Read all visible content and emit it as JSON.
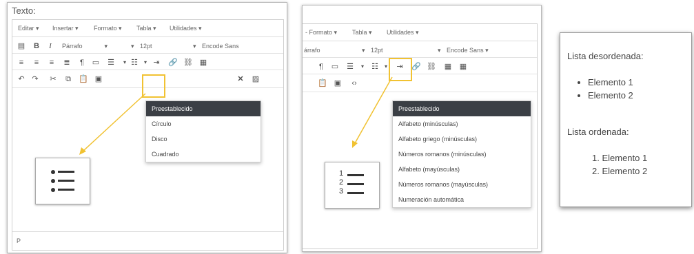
{
  "panel1": {
    "label": "Texto:",
    "menu": [
      "Editar",
      "Insertar",
      "Formato",
      "Tabla",
      "Utilidades"
    ],
    "paragraph_select": "Párrafo",
    "size_select": "12pt",
    "font_select": "Encode Sans",
    "dropdown_items": [
      "Preestablecido",
      "Círculo",
      "Disco",
      "Cuadrado"
    ],
    "status_path": "P"
  },
  "panel2": {
    "menu": [
      "Formato",
      "Tabla",
      "Utilidades"
    ],
    "paragraph_select": "árrafo",
    "size_select": "12pt",
    "font_select": "Encode Sans",
    "dropdown_items": [
      "Preestablecido",
      "Alfabeto (minúsculas)",
      "Alfabeto griego (minúsculas)",
      "Números romanos (minúsculas)",
      "Alfabeto (mayúsculas)",
      "Números romanos (mayúsculas)",
      "Numeración automática"
    ],
    "big_icon_numbers": [
      "1",
      "2",
      "3"
    ]
  },
  "panel3": {
    "unordered_title": "Lista desordenada:",
    "unordered_items": [
      "Elemento 1",
      "Elemento 2"
    ],
    "ordered_title": "Lista ordenada:",
    "ordered_items": [
      "1. Elemento 1",
      "2. Elemento 2"
    ]
  },
  "colors": {
    "highlight": "#f1c232",
    "active_item": "#3b3f45"
  }
}
